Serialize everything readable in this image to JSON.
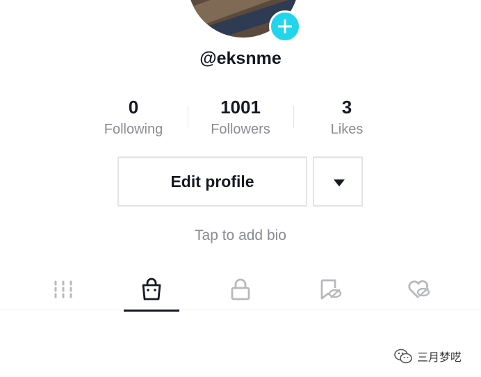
{
  "profile": {
    "username": "@eksnme",
    "bio_placeholder": "Tap to add bio"
  },
  "stats": [
    {
      "value": "0",
      "label": "Following"
    },
    {
      "value": "1001",
      "label": "Followers"
    },
    {
      "value": "3",
      "label": "Likes"
    }
  ],
  "actions": {
    "edit_profile_label": "Edit profile"
  },
  "tabs": [
    {
      "icon": "grid-icon",
      "active": false
    },
    {
      "icon": "shopping-bag-icon",
      "active": true
    },
    {
      "icon": "lock-icon",
      "active": false
    },
    {
      "icon": "bookmark-hidden-icon",
      "active": false
    },
    {
      "icon": "heart-hidden-icon",
      "active": false
    }
  ],
  "watermark": {
    "icon": "wechat-icon",
    "text": "三月梦呓"
  },
  "colors": {
    "accent": "#20d5ec",
    "text_primary": "#161823",
    "text_secondary": "#8a8b91",
    "border": "#e3e3e4"
  }
}
